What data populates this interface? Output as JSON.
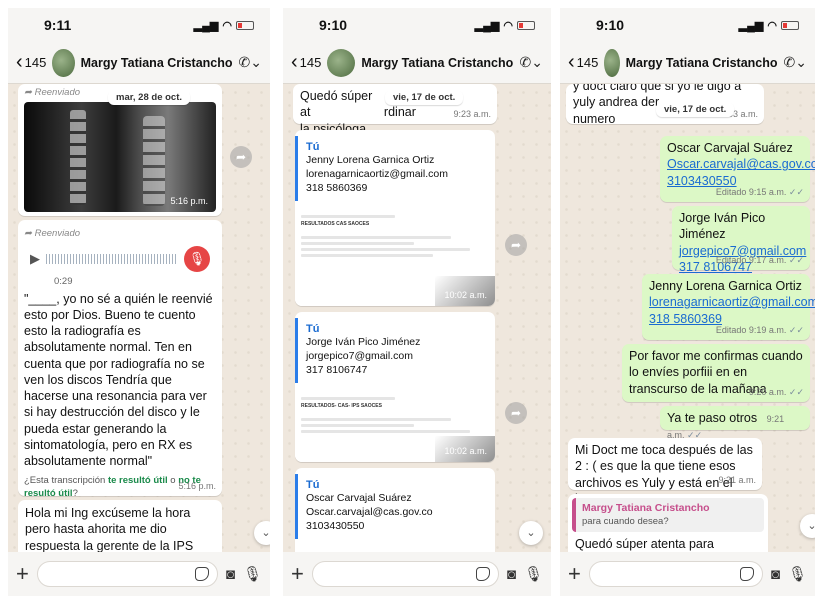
{
  "status_bar": [
    {
      "time": "9:11"
    },
    {
      "time": "9:10"
    },
    {
      "time": "9:10"
    }
  ],
  "header": {
    "back_count": "145",
    "contact": "Margy Tatiana Cristancho"
  },
  "phone1": {
    "date_pill": "mar, 28 de oct.",
    "forwarded": "Reenviado",
    "image_time": "5:16 p.m.",
    "audio_duration": "0:29",
    "transcript": "\"____, yo no sé a quién le reenvié esto por Dios. Bueno te cuento esto la radiografía es absolutamente normal. Ten en cuenta que por radiografía no se ven los discos Tendría que hacerse una resonancia para ver si hay destrucción del disco y le pueda estar generando la sintomatología, pero en RX es absolutamente normal\"",
    "feedback_prefix": "¿Esta transcripción",
    "feedback_yes": "te resultó útil",
    "feedback_or": "o",
    "feedback_no": "no te resultó útil",
    "feedback_suffix": "?",
    "audio_time": "5:16 p.m.",
    "last_message": "Hola mi Ing excúseme la hora pero hasta ahorita me dio respuesta la gerente de la IPS quien también es radióloga la Dra Julian"
  },
  "phone2": {
    "date_pill": "vie, 17 de oct.",
    "top_msg_a": "Quedó súper at",
    "top_msg_b": "rdinar",
    "top_msg_c": "la psicóloga",
    "top_time": "9:23 a.m.",
    "cards": [
      {
        "sender": "Tú",
        "name": "Jenny Lorena Garnica Ortiz",
        "email": "lorenagarnicaortiz@gmail.com",
        "phone": "318 5860369",
        "doc_title": "RESULTADOS CAS SAOCES",
        "time": "10:02 a.m."
      },
      {
        "sender": "Tú",
        "name": "Jorge Iván Pico Jiménez",
        "email": "jorgepico7@gmail.com",
        "phone": "317 8106747",
        "doc_title": "RESULTADOS- CAS- IPS SAOCES",
        "time": "10:02 a.m."
      },
      {
        "sender": "Tú",
        "name": "Oscar Carvajal Suárez",
        "email": "Oscar.carvajal@cas.gov.co",
        "phone": "3103430550"
      }
    ]
  },
  "phone3": {
    "date_pill": "vie, 17 de oct.",
    "top_msg_a": "y doct claro que si yo le digo a",
    "top_msg_b": "yuly andrea der",
    "top_msg_c": "numero",
    "top_time": "9:03 a.m.",
    "contacts": [
      {
        "name": "Oscar Carvajal Suárez",
        "email": "Oscar.carvajal@cas.gov.co",
        "phone": "3103430550",
        "time": "Editado 9:15 a.m."
      },
      {
        "name": "Jorge Iván Pico Jiménez",
        "email": "jorgepico7@gmail.com",
        "phone": "317 8106747",
        "time": "Editado 9:17 a.m."
      },
      {
        "name": "Jenny Lorena Garnica Ortiz",
        "email": "lorenagarnicaortiz@gmail.com",
        "phone": "318 5860369",
        "time": "Editado 9:19 a.m."
      }
    ],
    "confirm_msg": "Por favor me confirmas cuando lo envíes porfiii en en transcurso de la mañana",
    "confirm_time": "9:20 a.m.",
    "passing_msg": "Ya te paso otros",
    "passing_time": "9:21 a.m.",
    "reply_msg": "Mi Doct me toca después de las 2 : ( es que la que tiene esos archivos es Yuly y está en el inpec",
    "reply_time": "9:21 a.m.",
    "quote_name": "Margy Tatiana Cristancho",
    "quote_text": "para cuando desea?",
    "last_msg": "Quedó súper atenta para coordinar"
  }
}
